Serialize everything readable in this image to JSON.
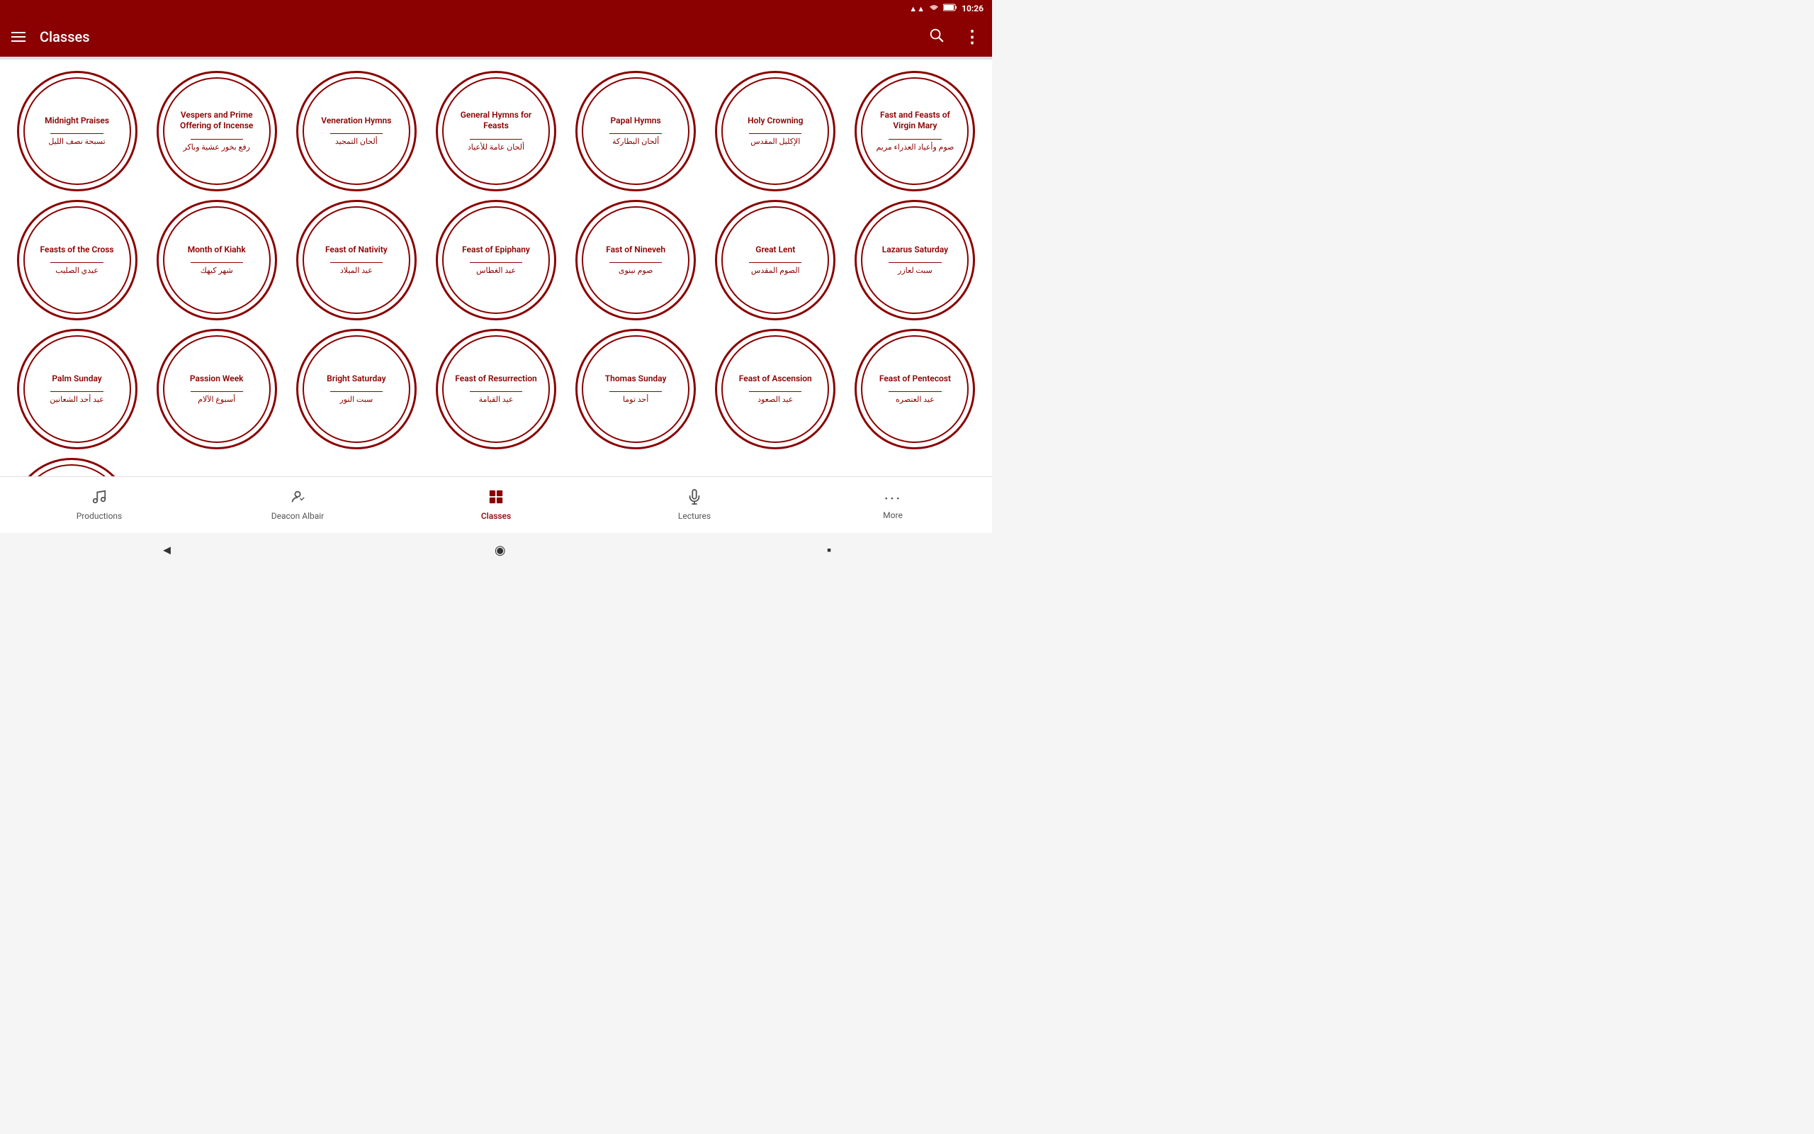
{
  "statusBar": {
    "time": "10:26",
    "icons": [
      "signal",
      "wifi",
      "battery"
    ]
  },
  "appBar": {
    "title": "Classes",
    "menuIcon": "☰",
    "searchIcon": "⌕",
    "moreIcon": "⋮"
  },
  "circles": [
    {
      "en": "Midnight Praises",
      "ar": "تسبحة نصف الليل"
    },
    {
      "en": "Vespers and Prime Offering of Incense",
      "ar": "رفع بخور عشية وباكر"
    },
    {
      "en": "Veneration Hymns",
      "ar": "ألحان التمجيد"
    },
    {
      "en": "General Hymns for Feasts",
      "ar": "ألحان عامة للأعياد"
    },
    {
      "en": "Papal Hymns",
      "ar": "ألحان البطاركة"
    },
    {
      "en": "Holy Crowning",
      "ar": "الإكليل المقدس"
    },
    {
      "en": "Fast and Feasts of Virgin Mary",
      "ar": "صوم وأعياد العذراء مريم"
    },
    {
      "en": "Feasts of the Cross",
      "ar": "عيدي الصليب"
    },
    {
      "en": "Month of Kiahk",
      "ar": "شهر كيهك"
    },
    {
      "en": "Feast of Nativity",
      "ar": "عيد الميلاد"
    },
    {
      "en": "Feast of Epiphany",
      "ar": "عيد الغطاس"
    },
    {
      "en": "Fast of Nineveh",
      "ar": "صوم نينوى"
    },
    {
      "en": "Great Lent",
      "ar": "الصوم المقدس"
    },
    {
      "en": "Lazarus Saturday",
      "ar": "سبت لعازر"
    },
    {
      "en": "Palm Sunday",
      "ar": "عيد أحد الشعانين"
    },
    {
      "en": "Passion Week",
      "ar": "أسبوع الآلام"
    },
    {
      "en": "Bright Saturday",
      "ar": "سبت النور"
    },
    {
      "en": "Feast of Resurrection",
      "ar": "عيد القيامة"
    },
    {
      "en": "Thomas Sunday",
      "ar": "أحد توما"
    },
    {
      "en": "Feast of Ascension",
      "ar": "عيد الصعود"
    },
    {
      "en": "Feast of Pentecost",
      "ar": "عيد العنصره"
    },
    {
      "en": "...",
      "ar": "..."
    }
  ],
  "bottomNav": {
    "items": [
      {
        "label": "Productions",
        "icon": "♪",
        "active": false
      },
      {
        "label": "Deacon Albair",
        "icon": "👤",
        "active": false
      },
      {
        "label": "Classes",
        "icon": "⊞",
        "active": true
      },
      {
        "label": "Lectures",
        "icon": "🎤",
        "active": false
      },
      {
        "label": "More",
        "icon": "•••",
        "active": false
      }
    ]
  },
  "sysNav": {
    "back": "◄",
    "home": "◉",
    "recent": "▪"
  }
}
